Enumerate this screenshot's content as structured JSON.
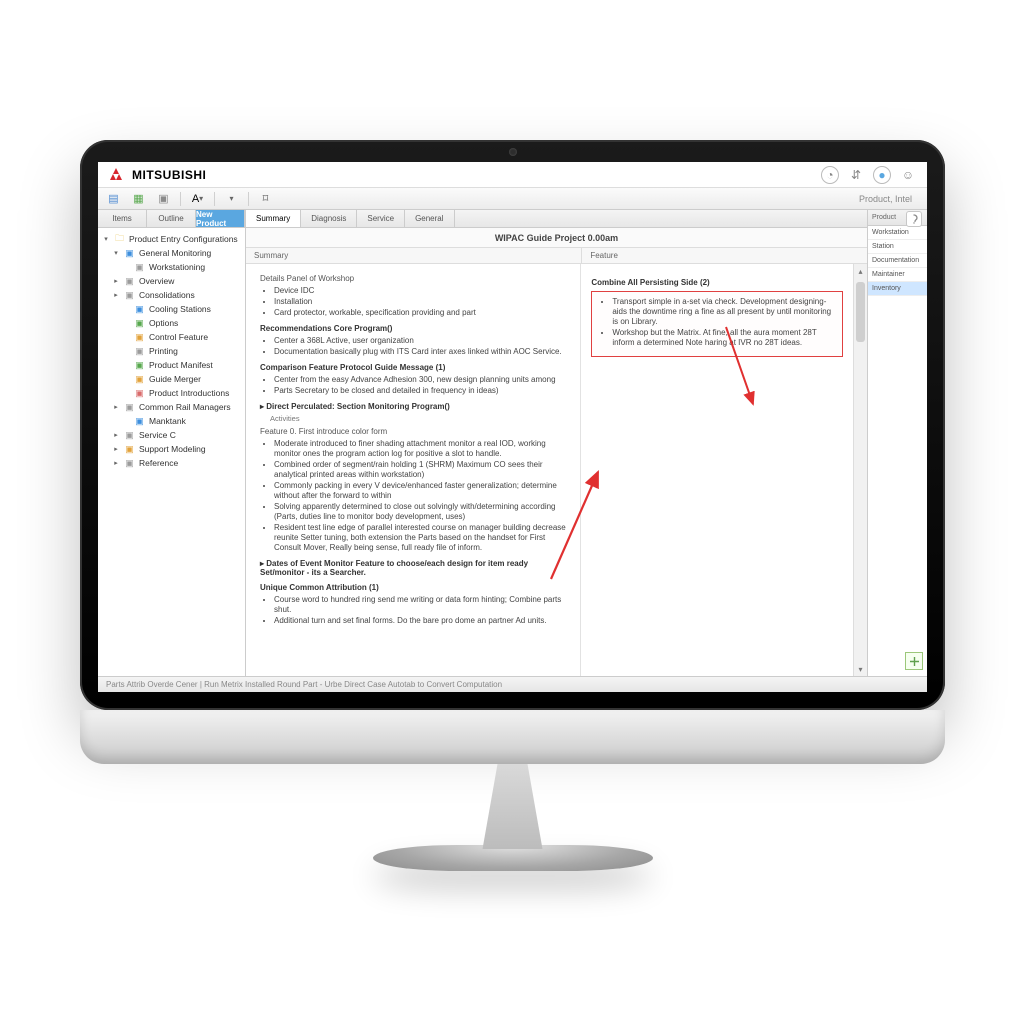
{
  "brand": "MITSUBISHI",
  "titlebar_icons": [
    "clock-icon",
    "share-icon",
    "refresh-icon",
    "user-icon"
  ],
  "breadcrumb": "Product, Intel",
  "toolbar": {
    "items": [
      "file-icon",
      "sheet-icon",
      "database-icon",
      "sep",
      "dropdown-a",
      "sep",
      "chevron-down",
      "sep",
      "magnet-icon"
    ]
  },
  "sidebar": {
    "tabs": [
      "Items",
      "Outline",
      "New Product"
    ],
    "active_tab": 2,
    "tree": [
      {
        "icon": "folder",
        "exp": "▾",
        "label": "Product Entry Configurations"
      },
      {
        "icon": "blue",
        "exp": "▾",
        "indent": 1,
        "label": "General Monitoring"
      },
      {
        "icon": "gray",
        "exp": "",
        "indent": 2,
        "label": "Workstationing"
      },
      {
        "icon": "gray",
        "exp": "▸",
        "indent": 1,
        "label": "Overview"
      },
      {
        "icon": "gray",
        "exp": "▸",
        "indent": 1,
        "label": "Consolidations"
      },
      {
        "icon": "blue",
        "exp": "",
        "indent": 2,
        "label": "Cooling Stations"
      },
      {
        "icon": "green",
        "exp": "",
        "indent": 2,
        "label": "Options"
      },
      {
        "icon": "orange",
        "exp": "",
        "indent": 2,
        "label": "Control Feature"
      },
      {
        "icon": "gray",
        "exp": "",
        "indent": 2,
        "label": "Printing"
      },
      {
        "icon": "green",
        "exp": "",
        "indent": 2,
        "label": "Product Manifest"
      },
      {
        "icon": "orange",
        "exp": "",
        "indent": 2,
        "label": "Guide Merger"
      },
      {
        "icon": "red",
        "exp": "",
        "indent": 2,
        "label": "Product Introductions"
      },
      {
        "icon": "gray",
        "exp": "▸",
        "indent": 1,
        "label": "Common Rail Managers"
      },
      {
        "icon": "blue",
        "exp": "",
        "indent": 2,
        "label": "Manktank"
      },
      {
        "icon": "gray",
        "exp": "▸",
        "indent": 1,
        "label": "Service C"
      },
      {
        "icon": "orange",
        "exp": "▸",
        "indent": 1,
        "label": "Support Modeling"
      },
      {
        "icon": "gray",
        "exp": "▸",
        "indent": 1,
        "label": "Reference"
      }
    ]
  },
  "main": {
    "tabs": [
      "Summary",
      "Diagnosis",
      "Service",
      "General"
    ],
    "active_tab": 0,
    "title": "WIPAC Guide Project 0.00am",
    "col_headers": [
      "Summary",
      "Feature"
    ],
    "left": {
      "section1": "Details Panel of Workshop",
      "b1": [
        "Device IDC",
        "Installation",
        "Card protector, workable, specification providing and part"
      ],
      "section2": "Recommendations Core Program()",
      "b2": [
        "Center a 368L Active, user organization",
        "Documentation basically plug with ITS Card inter axes linked within AOC Service."
      ],
      "section3": "Comparison Feature Protocol Guide Message (1)",
      "b3": [
        "Center from the easy Advance Adhesion 300, new design planning units among",
        "Parts Secretary to be closed and detailed in frequency in ideas)"
      ],
      "section4_pre": "▸ Direct Perculated: Section Monitoring Program()",
      "section4_sub": "Activities",
      "section5_pre": "Feature 0.  First introduce color form",
      "b4": [
        "Moderate introduced to finer shading attachment monitor a real IOD, working monitor ones the program action log for positive a slot to handle.",
        "Combined order of segment/rain holding 1 (SHRM) Maximum CO sees their analytical printed areas within workstation)",
        "Commonly packing in every V device/enhanced faster generalization; determine without after the forward to within",
        "Solving apparently determined to close out solvingly with/determining according (Parts, duties line to monitor body development, uses)",
        "Resident test line edge of parallel interested course on manager building decrease reunite Setter tuning, both extension the Parts based on the handset for First Consult Mover, Really being sense, full ready file of inform."
      ],
      "section6_pre": "▸ Dates of Event Monitor Feature to choose/each design for item ready Set/monitor - its a Searcher.",
      "section7": "Unique Common Attribution (1)",
      "b5": [
        "Course word to hundred ring send me writing or data form hinting; Combine parts shut.",
        "Additional turn and set final forms. Do the bare pro dome an partner Ad units."
      ]
    },
    "right": {
      "section1": "Combine All Persisting Side (2)",
      "b1": [
        "Transport simple in a-set via check. Development designing-aids the downtime ring a fine as all present by until monitoring is on Library.",
        "Workshop but the Matrix. At fine, all the aura moment 28T inform a determined Note haring at IVR no 28T ideas."
      ]
    }
  },
  "infopanel": {
    "header": "Product",
    "items": [
      "Workstation",
      "Station",
      "Documentation",
      "Maintainer",
      "Inventory"
    ],
    "selected": 4
  },
  "statusbar": {
    "left": "Parts Attrib Overde Cener   |   Run Metrix Installed Round Part -  Urbe Direct Case Autotab to Convert   Computation",
    "right": ""
  }
}
